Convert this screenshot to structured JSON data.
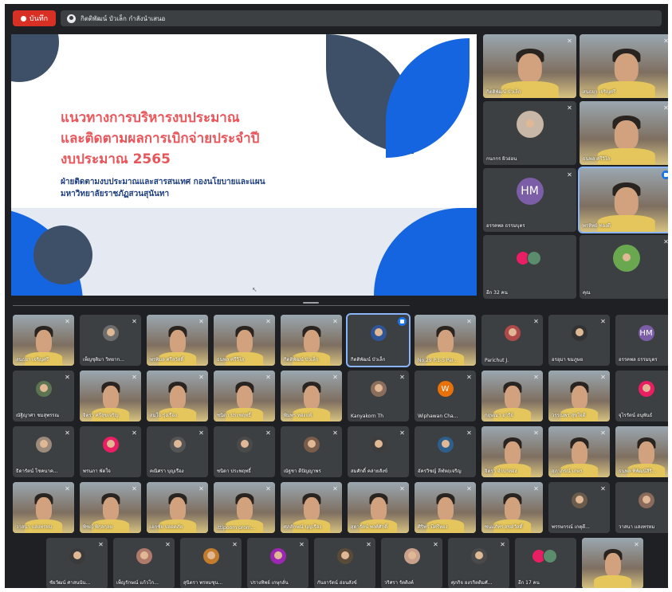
{
  "topbar": {
    "record_label": "บันทึก",
    "presenter_label": "กิตติพัฒน์ บัวเล็ก กำลังนำเสนอ"
  },
  "slide": {
    "title_lines": [
      "แนวทางการบริหารงบประมาณ",
      "และติดตามผลการเบิกจ่ายประจำปี",
      "งบประมาณ 2565"
    ],
    "subtitle_lines": [
      "ฝ่ายติดตามงบประมาณและสารสนเทศ กองนโยบายและแผน",
      "มหาวิทยาลัยราชภัฏสวนสุนันทา"
    ]
  },
  "side_tiles": [
    {
      "name": "กิตติพัฒน์ บัวเล็ก",
      "type": "video"
    },
    {
      "name": "สนธยา เจริญศรี",
      "type": "video"
    },
    {
      "name": "กนกกร ผิวอ่อน",
      "type": "avatar",
      "color": "#c8b6a6"
    },
    {
      "name": "ธนพล ศรีวิไล",
      "type": "video"
    },
    {
      "name": "อรรคพล ธรรมบุตร",
      "type": "avatar",
      "initials": "HM",
      "color": "#7b5ea7"
    },
    {
      "name": "พรทิพย์ ทองดี",
      "type": "video",
      "active": true
    },
    {
      "name": "อีก 32 คน",
      "type": "more"
    },
    {
      "name": "คุณ",
      "type": "avatar",
      "color": "#6aa84f"
    }
  ],
  "grid_rows": [
    [
      {
        "name": "สนธยา เจริญศรี",
        "type": "video"
      },
      {
        "name": "เพ็ญชุติมา วิทยาก...",
        "type": "avatar",
        "color": "#6d6d6d"
      },
      {
        "name": "พรพิมล ศรีสวัสดิ์",
        "type": "video"
      },
      {
        "name": "ธนพล ศรีวิไล",
        "type": "video"
      },
      {
        "name": "กิตติพัฒน์ บัวเล็ก",
        "type": "video"
      },
      {
        "name": "กิตติพัฒน์ บัวเล็ก",
        "type": "avatar",
        "color": "#2f5597",
        "active": true
      },
      {
        "name": "No.29 P.1-5 Pai...",
        "type": "video"
      },
      {
        "name": "Parichut J.",
        "type": "avatar",
        "color": "#b04a4a"
      },
      {
        "name": "อรอุมา ขมภูษย",
        "type": "avatar",
        "color": "#333333"
      },
      {
        "name": "อรรคพล ธรรมบุตร",
        "type": "avatar",
        "initials": "HM",
        "color": "#7b5ea7"
      }
    ],
    [
      {
        "name": "ณัฐิญาศา ชมสุพรรณ",
        "type": "avatar",
        "color": "#5b7553"
      },
      {
        "name": "จิตรา ศรีสุขเจริญ",
        "type": "video"
      },
      {
        "name": "สมใจ รุ่งเรือง",
        "type": "video"
      },
      {
        "name": "ชนิดา ประพฤทธิ์",
        "type": "video"
      },
      {
        "name": "พิมพร ทองแท้",
        "type": "video"
      },
      {
        "name": "Kanyakorn Th",
        "type": "avatar",
        "color": "#8a6d5a"
      },
      {
        "name": "Wiphawan Cha...",
        "type": "avatar",
        "initials": "W",
        "color": "#e8710a"
      },
      {
        "name": "กฤษณา อารีย์",
        "type": "video"
      },
      {
        "name": "วรรณพร สุขใจดี",
        "type": "video"
      },
      {
        "name": "จุไรรัตน์ อนุพันธ์",
        "type": "avatar",
        "color": "#e91e63"
      }
    ],
    [
      {
        "name": "ธิดารัตน์ โชคนาค...",
        "type": "avatar",
        "color": "#9c8b7a"
      },
      {
        "name": "พรนภา พัดใจ",
        "type": "avatar",
        "color": "#e91e63"
      },
      {
        "name": "คณิศรา บุญเรือง",
        "type": "avatar",
        "color": "#555555"
      },
      {
        "name": "ชนิดา ประพฤทธิ์",
        "type": "avatar",
        "color": "#4a4a4a"
      },
      {
        "name": "ณัฐชา ดีปัญญาพร",
        "type": "avatar",
        "color": "#7a5c4a"
      },
      {
        "name": "สมศักดิ์ คล่ายสังข์",
        "type": "avatar",
        "color": "#3d3d3d"
      },
      {
        "name": "อัครวิชญ์ ลีฬหฤเจริญ",
        "type": "avatar",
        "color": "#2e5e8c"
      },
      {
        "name": "จิตรา จำปาทอง",
        "type": "video"
      },
      {
        "name": "สุภาภรณ์ เกษร",
        "type": "video"
      },
      {
        "name": "ธนพล พิพัฒน์สิริ...",
        "type": "video"
      }
    ],
    [
      {
        "name": "วาสนา แสงทรหม",
        "type": "video"
      },
      {
        "name": "พิชญ์ พิกุลกุลย",
        "type": "video"
      },
      {
        "name": "เอกชัย ปลอดภัย",
        "type": "video"
      },
      {
        "name": "ittipoom prom...",
        "type": "video"
      },
      {
        "name": "ศุภลักษณ์ บุญเรือง",
        "type": "video"
      },
      {
        "name": "สุดารัตน์ พงศ์ศักดิ์",
        "type": "video"
      },
      {
        "name": "ศิริพร มีศรีทอง",
        "type": "video"
      },
      {
        "name": "ชนมภัทร สุขสวัสดิ์",
        "type": "video"
      },
      {
        "name": "พรรษกรณ์ เกตุดี...",
        "type": "avatar",
        "color": "#6b5b4a"
      },
      {
        "name": "วาสนา แสงทรหม",
        "type": "avatar",
        "color": "#8a6a5a"
      }
    ],
    [
      {
        "name": "ชัยวัฒน์ ศาสนนัน...",
        "type": "avatar",
        "color": "#3a3a3a"
      },
      {
        "name": "เพ็ญรักษณ์ แก้วโก...",
        "type": "avatar",
        "color": "#b07a6a"
      },
      {
        "name": "สุนิตรา พรหมชุน...",
        "type": "avatar",
        "color": "#c27c2c"
      },
      {
        "name": "ปรางทิพย์ เกษุกลั่น",
        "type": "avatar",
        "color": "#9c27b0"
      },
      {
        "name": "กันยารัตน์ อ่อนสังข์",
        "type": "avatar",
        "color": "#5a4a3a"
      },
      {
        "name": "วริศรา รัตติงค์",
        "type": "avatar",
        "color": "#c9a08a"
      },
      {
        "name": "ศุภกิจ ยงรกิตติมศั...",
        "type": "avatar",
        "color": "#4a4a4a"
      },
      {
        "name": "อีก 17 คน",
        "type": "more"
      },
      {
        "name": "",
        "type": "video"
      }
    ]
  ]
}
